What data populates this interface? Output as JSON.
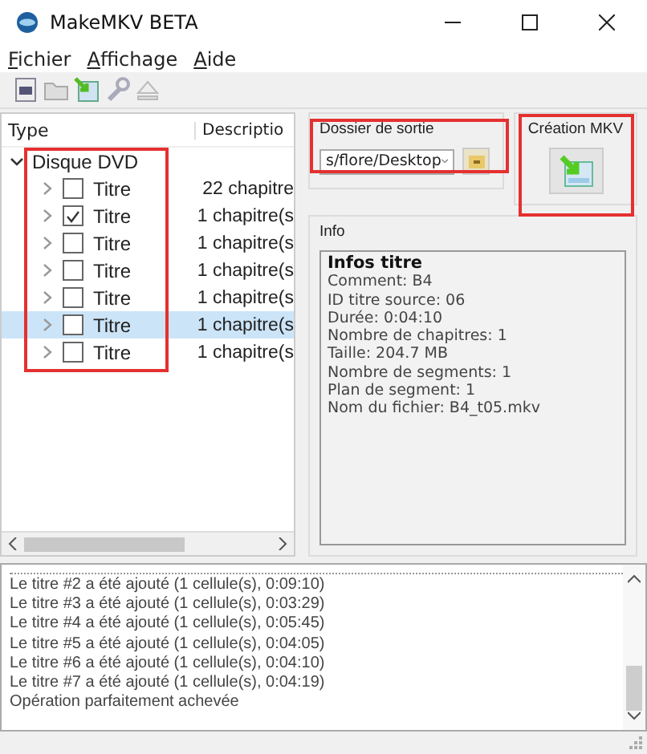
{
  "window": {
    "title": "MakeMKV BETA"
  },
  "menu": [
    {
      "label": "Fichier"
    },
    {
      "label": "Affichage"
    },
    {
      "label": "Aide"
    }
  ],
  "tree": {
    "columns": [
      "Type",
      "Descriptio"
    ],
    "root": {
      "label": "Disque DVD",
      "expanded": true,
      "children": [
        {
          "label": "Titre",
          "description": "22 chapitre",
          "checked": false,
          "selected": false
        },
        {
          "label": "Titre",
          "description": "1 chapitre(s",
          "checked": true,
          "selected": false
        },
        {
          "label": "Titre",
          "description": "1 chapitre(s",
          "checked": false,
          "selected": false
        },
        {
          "label": "Titre",
          "description": "1 chapitre(s",
          "checked": false,
          "selected": false
        },
        {
          "label": "Titre",
          "description": "1 chapitre(s",
          "checked": false,
          "selected": false
        },
        {
          "label": "Titre",
          "description": "1 chapitre(s",
          "checked": false,
          "selected": true
        },
        {
          "label": "Titre",
          "description": "1 chapitre(s",
          "checked": false,
          "selected": false
        }
      ]
    }
  },
  "output": {
    "title": "Dossier de sortie",
    "folder": "s/flore/Desktop"
  },
  "create": {
    "title": "Création MKV"
  },
  "info": {
    "title": "Info",
    "heading": "Infos titre",
    "lines": [
      "Comment: B4",
      "ID titre source: 06",
      "Durée: 0:04:10",
      "Nombre de chapitres: 1",
      "Taille: 204.7 MB",
      "Nombre de segments: 1",
      "Plan de segment: 1",
      "Nom du fichier: B4_t05.mkv"
    ]
  },
  "log": [
    "Le titre #2 a été ajouté (1 cellule(s), 0:09:10)",
    "Le titre #3 a été ajouté (1 cellule(s), 0:03:29)",
    "Le titre #4 a été ajouté (1 cellule(s), 0:05:45)",
    "Le titre #5 a été ajouté (1 cellule(s), 0:04:05)",
    "Le titre #6 a été ajouté (1 cellule(s), 0:04:10)",
    "Le titre #7 a été ajouté (1 cellule(s), 0:04:19)",
    "Opération parfaitement achevée"
  ]
}
